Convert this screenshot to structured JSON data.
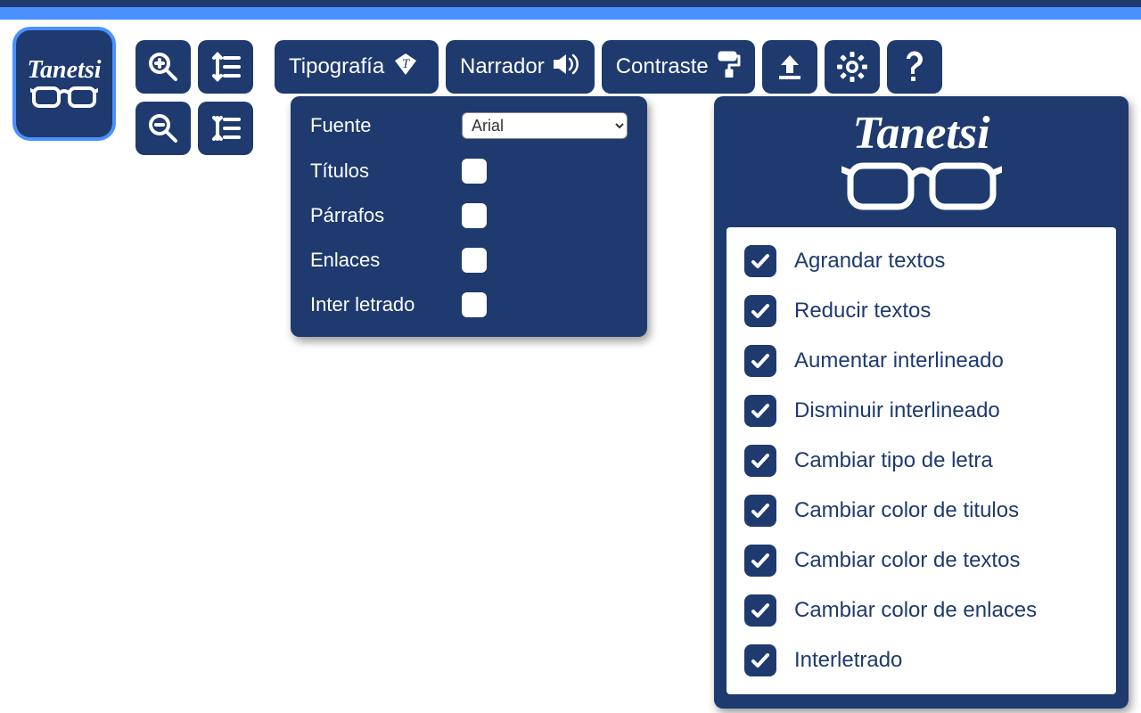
{
  "brand": "Tanetsi",
  "colors": {
    "primary": "#1e3a6e",
    "accent": "#4a90ff"
  },
  "toolbar": {
    "tipografia_label": "Tipografía",
    "narrador_label": "Narrador",
    "contraste_label": "Contraste"
  },
  "typography_panel": {
    "rows": {
      "fuente_label": "Fuente",
      "fuente_value": "Arial",
      "titulos_label": "Títulos",
      "parrafos_label": "Párrafos",
      "enlaces_label": "Enlaces",
      "interletrado_label": "Inter letrado"
    }
  },
  "settings_list": [
    {
      "label": "Agrandar textos",
      "checked": true
    },
    {
      "label": "Reducir textos",
      "checked": true
    },
    {
      "label": "Aumentar interlineado",
      "checked": true
    },
    {
      "label": "Disminuir interlineado",
      "checked": true
    },
    {
      "label": "Cambiar tipo de letra",
      "checked": true
    },
    {
      "label": "Cambiar color de titulos",
      "checked": true
    },
    {
      "label": "Cambiar color de textos",
      "checked": true
    },
    {
      "label": "Cambiar color de enlaces",
      "checked": true
    },
    {
      "label": "Interletrado",
      "checked": true
    }
  ]
}
